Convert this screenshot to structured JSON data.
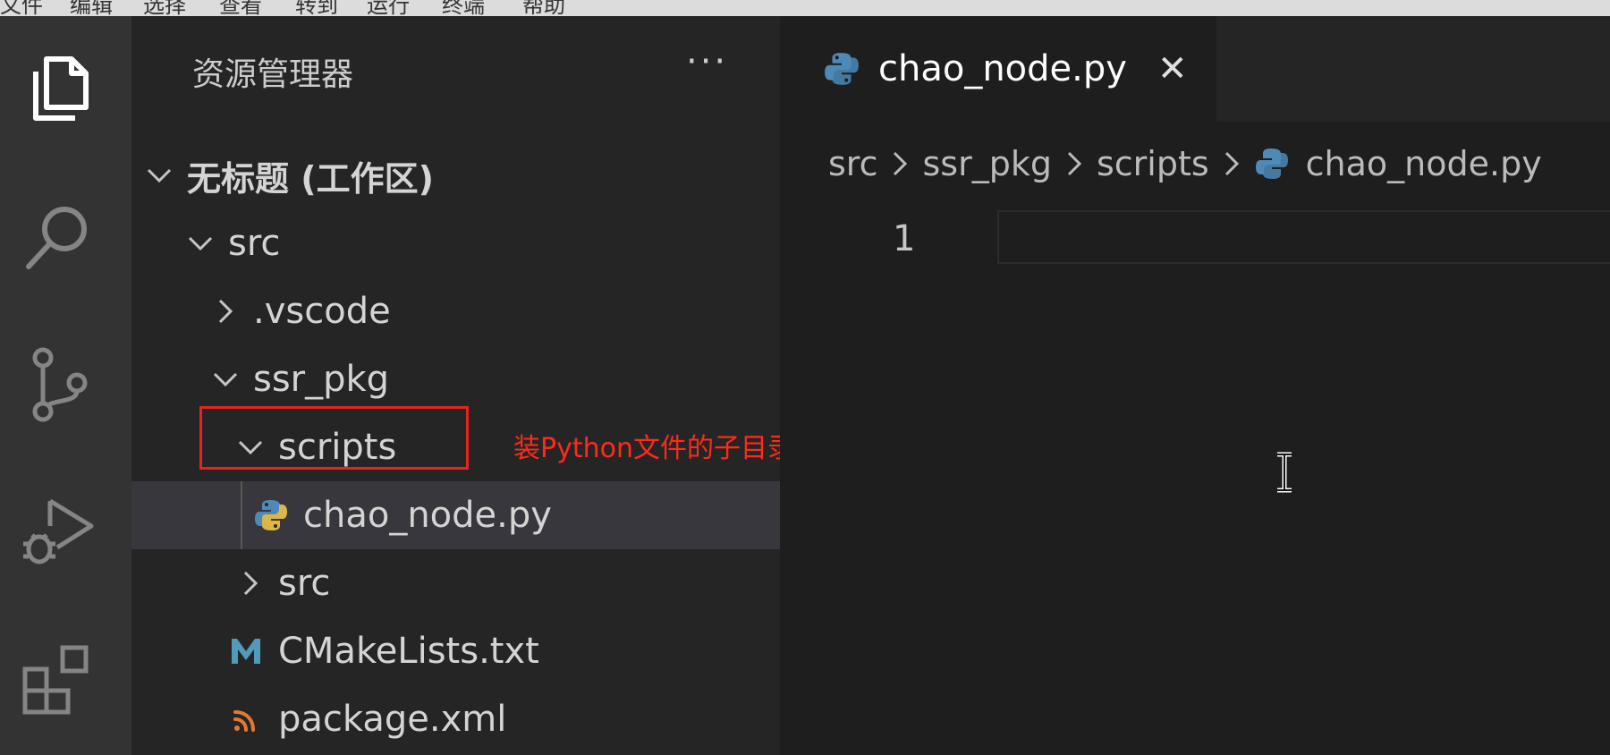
{
  "menubar": {
    "items": [
      "文件",
      "编辑",
      "选择",
      "查看",
      "转到",
      "运行",
      "终端",
      "帮助"
    ]
  },
  "activity_bar": {
    "icons": [
      "explorer-icon",
      "search-icon",
      "source-control-icon",
      "run-debug-icon",
      "extensions-icon"
    ]
  },
  "explorer": {
    "title": "资源管理器",
    "more_label": "···",
    "workspace": "无标题 (工作区)",
    "tree": [
      {
        "label": "src",
        "expanded": true
      },
      {
        "label": ".vscode",
        "expanded": false
      },
      {
        "label": "ssr_pkg",
        "expanded": true
      },
      {
        "label": "scripts",
        "expanded": true
      },
      {
        "label": "chao_node.py",
        "icon": "python-icon",
        "selected": true
      },
      {
        "label": "src",
        "expanded": false
      },
      {
        "label": "CMakeLists.txt",
        "icon": "cmake-m-icon"
      },
      {
        "label": "package.xml",
        "icon": "rss-xml-icon"
      }
    ]
  },
  "annotation": {
    "text": "装Python文件的子目录",
    "color": "#ff2a1a"
  },
  "editor": {
    "tab": {
      "label": "chao_node.py",
      "close": "✕"
    },
    "breadcrumb": [
      "src",
      "ssr_pkg",
      "scripts",
      "chao_node.py"
    ],
    "line_number": "1"
  },
  "colors": {
    "python_blue": "#4e8ab8",
    "python_yellow": "#ddb64a",
    "cmake_blue": "#519aba",
    "rss_orange": "#e37933",
    "highlight_red": "#e8231c"
  }
}
